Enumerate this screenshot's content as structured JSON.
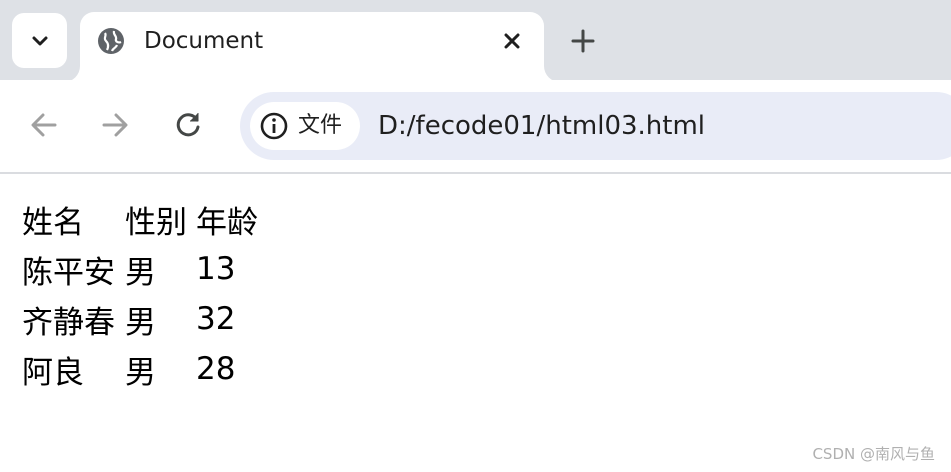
{
  "browser": {
    "tab": {
      "title": "Document",
      "favicon_icon": "globe-icon",
      "close_icon": "close-icon"
    },
    "tab_search_icon": "chevron-down-icon",
    "new_tab_icon": "plus-icon",
    "nav": {
      "back_icon": "back-arrow-icon",
      "forward_icon": "forward-arrow-icon",
      "reload_icon": "reload-icon"
    },
    "omnibox": {
      "site_info_icon": "info-icon",
      "site_label": "文件",
      "url": "D:/fecode01/html03.html"
    }
  },
  "page": {
    "table": {
      "headers": [
        "姓名",
        "性别",
        "年龄"
      ],
      "rows": [
        [
          "陈平安",
          "男",
          "13"
        ],
        [
          "齐静春",
          "男",
          "32"
        ],
        [
          "阿良",
          "男",
          "28"
        ]
      ]
    },
    "watermark": "CSDN @南风与鱼"
  },
  "colors": {
    "tabstrip_bg": "#dee1e6",
    "omnibox_bg": "#e9ecf7",
    "icon_color": "#444746",
    "disabled_icon_color": "#a0a0a0"
  }
}
